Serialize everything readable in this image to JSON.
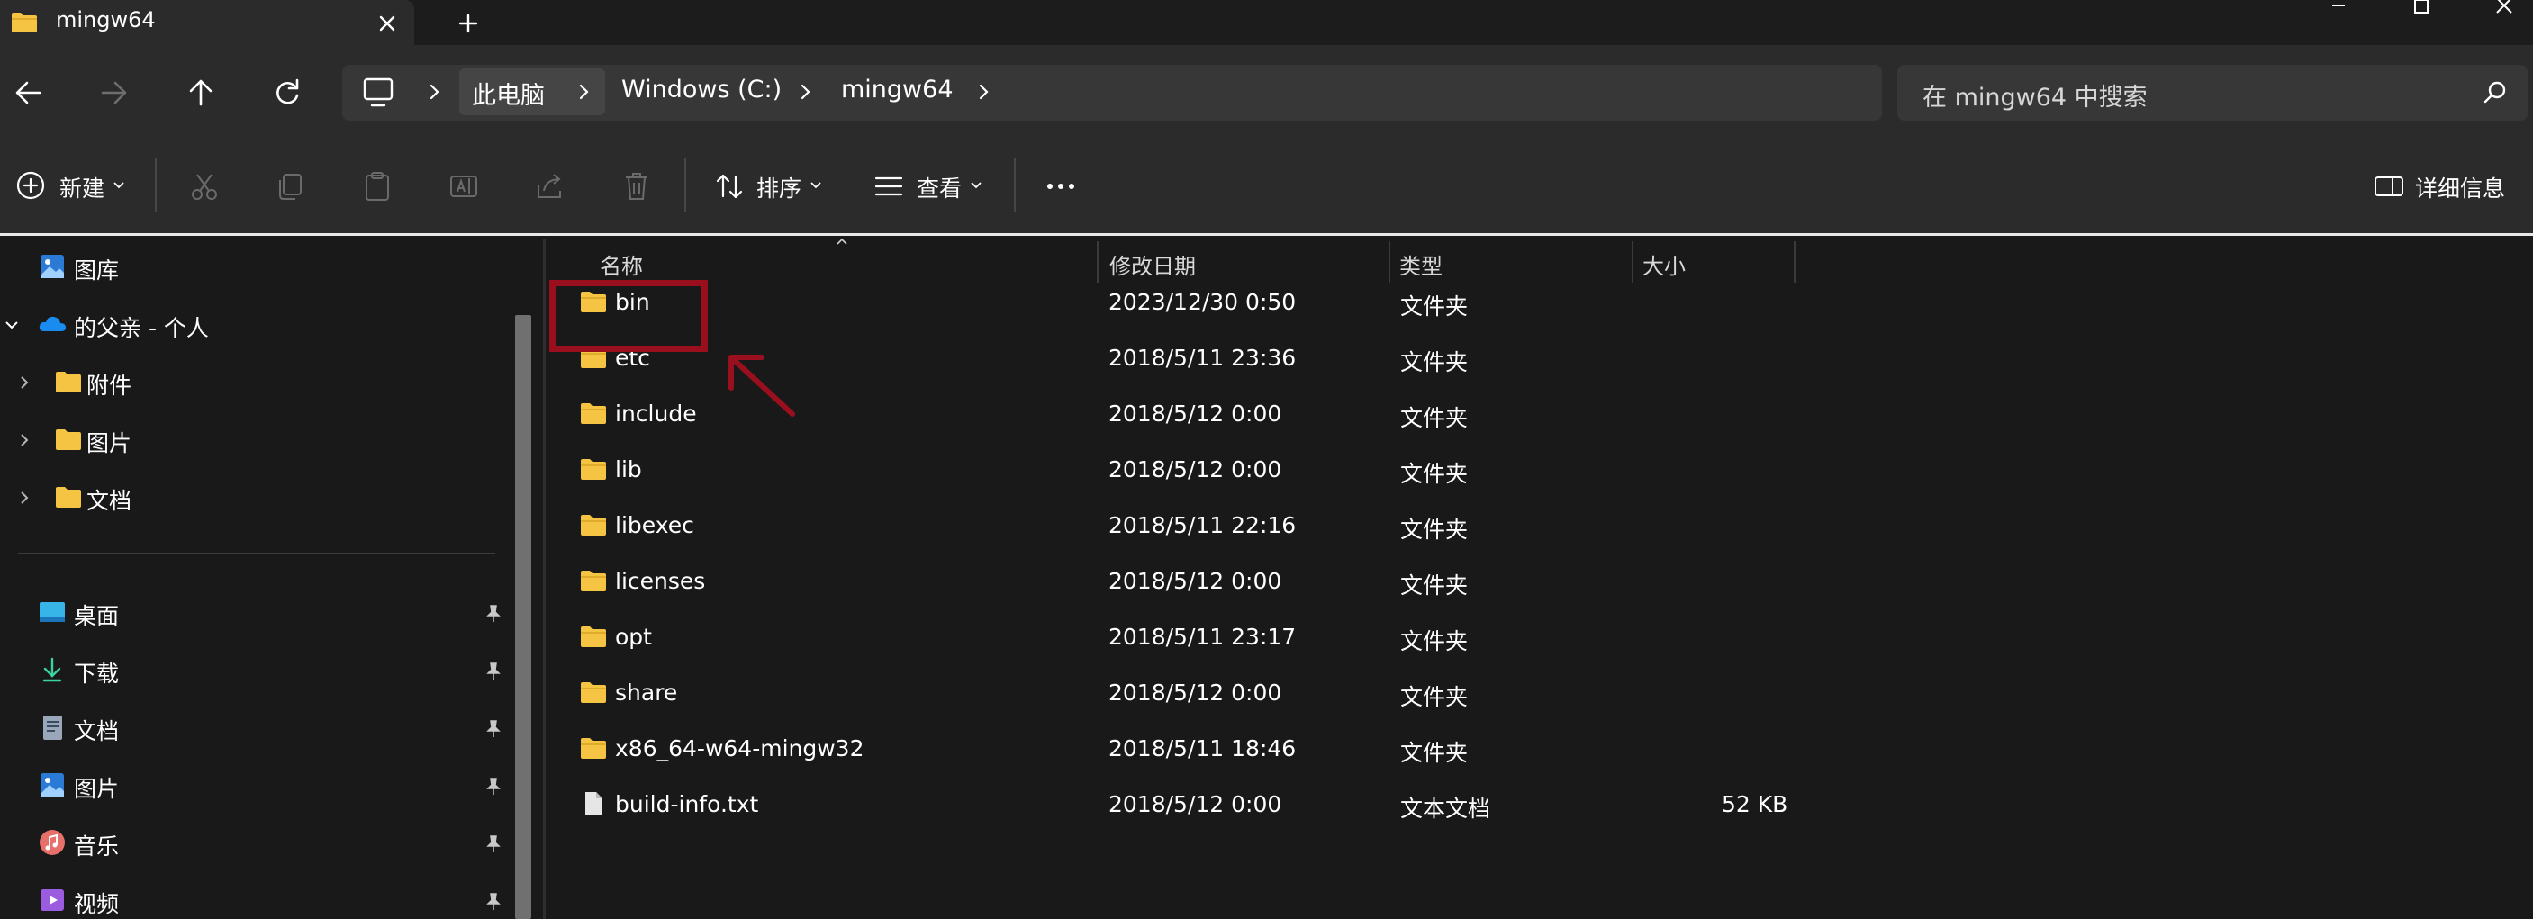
{
  "window": {
    "tab_title": "mingw64"
  },
  "address": {
    "breadcrumb": [
      "此电脑",
      "Windows (C:)",
      "mingw64"
    ],
    "search_placeholder": "在 mingw64 中搜索"
  },
  "toolbar": {
    "new_label": "新建",
    "sort_label": "排序",
    "view_label": "查看",
    "more_label": "···",
    "details_label": "详细信息"
  },
  "sidebar": {
    "top_items": [
      {
        "label": "图库",
        "icon": "gallery-icon"
      },
      {
        "label": "的父亲 - 个人",
        "icon": "onedrive-icon",
        "expanded": true
      },
      {
        "label": "附件",
        "icon": "folder-icon"
      },
      {
        "label": "图片",
        "icon": "folder-icon"
      },
      {
        "label": "文档",
        "icon": "folder-icon"
      }
    ],
    "quick_access": [
      {
        "label": "桌面",
        "icon": "desktop-icon"
      },
      {
        "label": "下载",
        "icon": "download-icon"
      },
      {
        "label": "文档",
        "icon": "document-icon"
      },
      {
        "label": "图片",
        "icon": "pictures-icon"
      },
      {
        "label": "音乐",
        "icon": "music-icon"
      },
      {
        "label": "视频",
        "icon": "video-icon"
      }
    ]
  },
  "file_list": {
    "columns": [
      "名称",
      "修改日期",
      "类型",
      "大小"
    ],
    "rows": [
      {
        "name": "bin",
        "date": "2023/12/30 0:50",
        "type": "文件夹",
        "size": "",
        "kind": "folder"
      },
      {
        "name": "etc",
        "date": "2018/5/11 23:36",
        "type": "文件夹",
        "size": "",
        "kind": "folder"
      },
      {
        "name": "include",
        "date": "2018/5/12 0:00",
        "type": "文件夹",
        "size": "",
        "kind": "folder"
      },
      {
        "name": "lib",
        "date": "2018/5/12 0:00",
        "type": "文件夹",
        "size": "",
        "kind": "folder"
      },
      {
        "name": "libexec",
        "date": "2018/5/11 22:16",
        "type": "文件夹",
        "size": "",
        "kind": "folder"
      },
      {
        "name": "licenses",
        "date": "2018/5/12 0:00",
        "type": "文件夹",
        "size": "",
        "kind": "folder"
      },
      {
        "name": "opt",
        "date": "2018/5/11 23:17",
        "type": "文件夹",
        "size": "",
        "kind": "folder"
      },
      {
        "name": "share",
        "date": "2018/5/12 0:00",
        "type": "文件夹",
        "size": "",
        "kind": "folder"
      },
      {
        "name": "x86_64-w64-mingw32",
        "date": "2018/5/11 18:46",
        "type": "文件夹",
        "size": "",
        "kind": "folder"
      },
      {
        "name": "build-info.txt",
        "date": "2018/5/12 0:00",
        "type": "文本文档",
        "size": "52 KB",
        "kind": "file"
      }
    ]
  },
  "colors": {
    "folder": "#f5c443",
    "highlight": "#9a0f1e",
    "background": "#191919",
    "panel": "#2b2b2b"
  }
}
